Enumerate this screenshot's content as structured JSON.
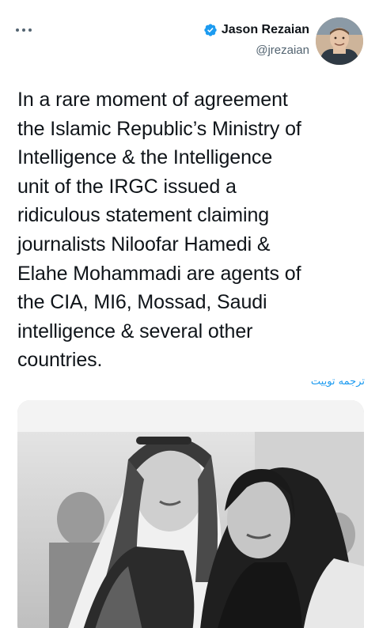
{
  "header": {
    "more_icon": "more-horizontal-icon",
    "author_name": "Jason Rezaian",
    "author_handle": "@jrezaian",
    "verified_icon": "verified-badge-icon",
    "verified_color": "#1d9bf0"
  },
  "tweet": {
    "lines": [
      "In a rare moment of agreement",
      "the Islamic Republic’s Ministry of",
      "Intelligence & the Intelligence",
      "unit of the IRGC issued a",
      "ridiculous statement claiming",
      "journalists Niloofar Hamedi &",
      "Elahe Mohammadi are agents of",
      "the CIA, MI6, Mossad, Saudi",
      "intelligence & several other",
      "countries."
    ],
    "translate_label": "ترجمه توییت"
  },
  "colors": {
    "text": "#0f1419",
    "secondary": "#536471",
    "link": "#1d9bf0"
  }
}
